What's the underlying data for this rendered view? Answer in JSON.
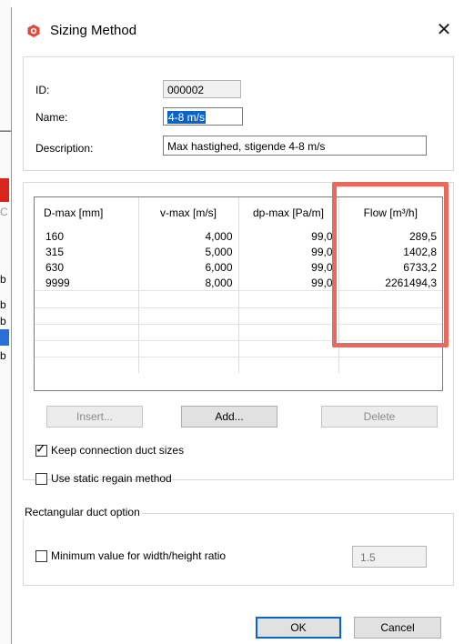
{
  "window": {
    "title": "Sizing Method",
    "close_glyph": "✕"
  },
  "form": {
    "id_label": "ID:",
    "id_value": "000002",
    "name_label": "Name:",
    "name_value": "4-8 m/s",
    "description_label": "Description:",
    "description_value": "Max hastighed, stigende 4-8 m/s"
  },
  "table": {
    "columns": [
      "D-max [mm]",
      "v-max [m/s]",
      "dp-max [Pa/m]",
      "Flow [m³/h]"
    ],
    "rows": [
      [
        "160",
        "4,000",
        "99,0",
        "289,5"
      ],
      [
        "315",
        "5,000",
        "99,0",
        "1402,8"
      ],
      [
        "630",
        "6,000",
        "99,0",
        "6733,2"
      ],
      [
        "9999",
        "8,000",
        "99,0",
        "2261494,3"
      ]
    ]
  },
  "buttons": {
    "insert": "Insert...",
    "add": "Add...",
    "delete": "Delete",
    "ok": "OK",
    "cancel": "Cancel"
  },
  "options": {
    "keep_connection_label": "Keep connection duct sizes",
    "keep_connection_checked": true,
    "static_regain_label": "Use static regain method",
    "static_regain_checked": false
  },
  "rectangular": {
    "group_title": "Rectangular duct option",
    "min_ratio_label": "Minimum value for width/height ratio",
    "min_ratio_checked": false,
    "ratio_value": "1.5"
  },
  "colors": {
    "highlight": "#e86a5f",
    "selection": "#0a64c8",
    "app_icon": "#e0483c"
  },
  "background": {
    "marks": [
      "—",
      "C",
      "b",
      "b",
      "b",
      "b"
    ]
  }
}
